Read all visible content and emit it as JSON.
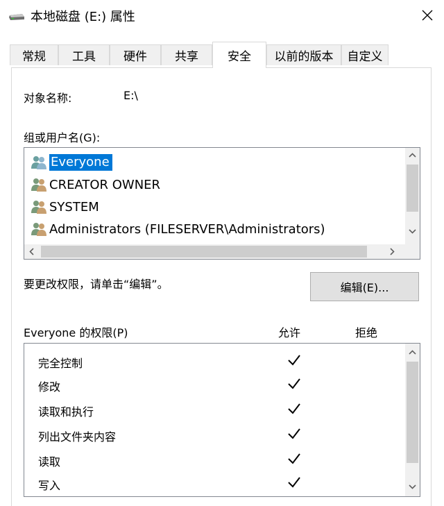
{
  "window": {
    "title": "本地磁盘 (E:) 属性",
    "icon": "drive-icon",
    "close_icon": "close-icon"
  },
  "tabs": [
    {
      "label": "常规",
      "active": false
    },
    {
      "label": "工具",
      "active": false
    },
    {
      "label": "硬件",
      "active": false
    },
    {
      "label": "共享",
      "active": false
    },
    {
      "label": "安全",
      "active": true
    },
    {
      "label": "以前的版本",
      "active": false
    },
    {
      "label": "自定义",
      "active": false
    }
  ],
  "security": {
    "object_name_label": "对象名称:",
    "object_name_value": "E:\\",
    "groups_label": "组或用户名(G):",
    "groups": [
      {
        "name": "Everyone",
        "selected": true,
        "icon": "users-icon"
      },
      {
        "name": "CREATOR OWNER",
        "selected": false,
        "icon": "users-icon"
      },
      {
        "name": "SYSTEM",
        "selected": false,
        "icon": "users-icon"
      },
      {
        "name": "Administrators (FILESERVER\\Administrators)",
        "selected": false,
        "icon": "users-icon"
      }
    ],
    "change_hint": "要更改权限，请单击“编辑”。",
    "edit_button": "编辑(E)...",
    "permissions_label": "Everyone 的权限(P)",
    "allow_header": "允许",
    "deny_header": "拒绝",
    "permissions": [
      {
        "name": "完全控制",
        "allow": true,
        "deny": false
      },
      {
        "name": "修改",
        "allow": true,
        "deny": false
      },
      {
        "name": "读取和执行",
        "allow": true,
        "deny": false
      },
      {
        "name": "列出文件夹内容",
        "allow": true,
        "deny": false
      },
      {
        "name": "读取",
        "allow": true,
        "deny": false
      },
      {
        "name": "写入",
        "allow": true,
        "deny": false
      }
    ]
  },
  "colors": {
    "selection": "#0078d7",
    "scrollbar_track": "#f0f0f0",
    "scrollbar_thumb": "#cdcdcd",
    "button_face": "#e1e1e1"
  }
}
